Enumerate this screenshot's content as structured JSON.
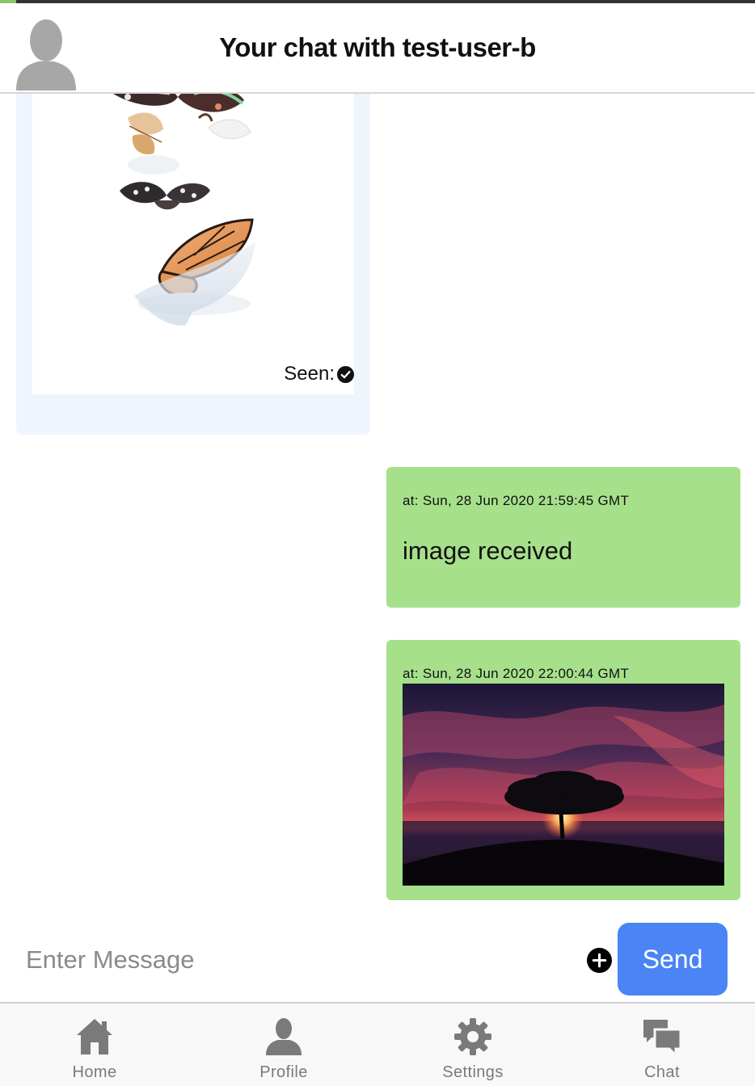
{
  "header": {
    "title": "Your chat with test-user-b",
    "avatar_icon": "user-silhouette-icon"
  },
  "messages": [
    {
      "direction": "incoming",
      "type": "image",
      "image_description_icon": "butterflies-image",
      "seen_label": "Seen:",
      "seen_icon": "check-circle-icon"
    },
    {
      "direction": "outgoing",
      "type": "text",
      "timestamp": "at: Sun, 28 Jun 2020 21:59:45 GMT",
      "text": "image received"
    },
    {
      "direction": "outgoing",
      "type": "image",
      "timestamp": "at: Sun, 28 Jun 2020 22:00:44 GMT",
      "image_description_icon": "sunset-tree-image"
    }
  ],
  "composer": {
    "placeholder": "Enter Message",
    "value": "",
    "attach_icon": "plus-circle-icon",
    "send_label": "Send"
  },
  "nav": [
    {
      "label": "Home",
      "icon": "home-icon"
    },
    {
      "label": "Profile",
      "icon": "profile-icon"
    },
    {
      "label": "Settings",
      "icon": "gear-icon"
    },
    {
      "label": "Chat",
      "icon": "chat-bubbles-icon"
    }
  ],
  "colors": {
    "incoming_bubble": "#eef5fd",
    "outgoing_bubble": "#a6e08b",
    "send_button": "#4a84f5",
    "nav_icon": "#7a7a7a"
  }
}
